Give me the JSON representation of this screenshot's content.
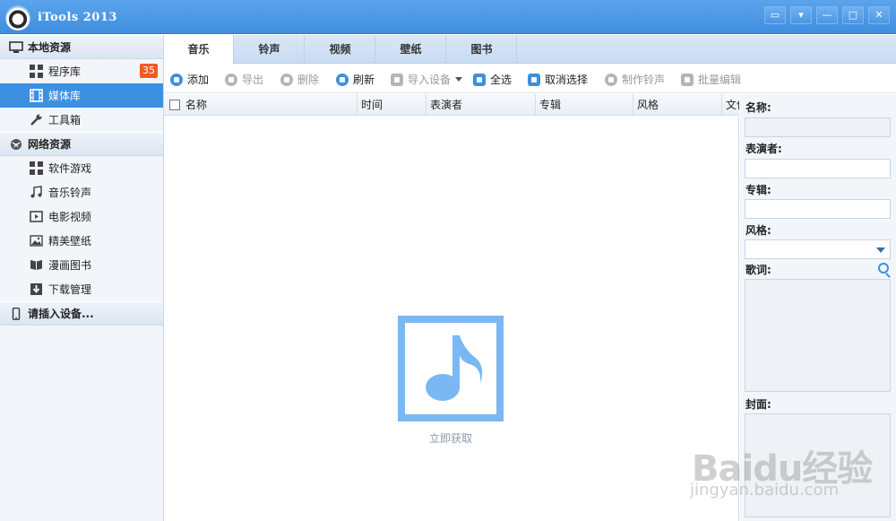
{
  "app": {
    "title": "iTools 2013"
  },
  "window_buttons": [
    "▭",
    "▾",
    "—",
    "□",
    "✕"
  ],
  "sidebar": {
    "sections": [
      {
        "label": "本地资源",
        "icon": "monitor-icon",
        "items": [
          {
            "label": "程序库",
            "icon": "grid-icon",
            "badge": "35",
            "active": false
          },
          {
            "label": "媒体库",
            "icon": "film-icon",
            "active": true
          },
          {
            "label": "工具箱",
            "icon": "wrench-icon",
            "active": false
          }
        ]
      },
      {
        "label": "网络资源",
        "icon": "globe-icon",
        "items": [
          {
            "label": "软件游戏",
            "icon": "grid-icon"
          },
          {
            "label": "音乐铃声",
            "icon": "music-note-icon"
          },
          {
            "label": "电影视频",
            "icon": "video-icon"
          },
          {
            "label": "精美壁纸",
            "icon": "picture-icon"
          },
          {
            "label": "漫画图书",
            "icon": "book-icon"
          },
          {
            "label": "下载管理",
            "icon": "download-icon"
          }
        ]
      },
      {
        "label": "请插入设备...",
        "icon": "phone-icon",
        "items": []
      }
    ]
  },
  "tabs": [
    "音乐",
    "铃声",
    "视频",
    "壁纸",
    "图书"
  ],
  "active_tab": "音乐",
  "toolbar": [
    {
      "label": "添加",
      "enabled": true,
      "icon": "add-icon"
    },
    {
      "label": "导出",
      "enabled": false,
      "icon": "export-icon"
    },
    {
      "label": "删除",
      "enabled": false,
      "icon": "delete-icon"
    },
    {
      "label": "刷新",
      "enabled": true,
      "icon": "refresh-icon"
    },
    {
      "label": "导入设备",
      "enabled": false,
      "icon": "import-device-icon",
      "dropdown": true
    },
    {
      "label": "全选",
      "enabled": true,
      "icon": "select-all-icon"
    },
    {
      "label": "取消选择",
      "enabled": true,
      "icon": "deselect-icon"
    },
    {
      "label": "制作铃声",
      "enabled": false,
      "icon": "make-ringtone-icon"
    },
    {
      "label": "批量编辑",
      "enabled": false,
      "icon": "batch-edit-icon"
    }
  ],
  "table": {
    "columns": [
      "名称",
      "时间",
      "表演者",
      "专辑",
      "风格",
      "文件"
    ],
    "rows": []
  },
  "empty_state": {
    "icon": "music-note-icon",
    "label": "立即获取"
  },
  "details": {
    "name_label": "名称:",
    "artist_label": "表演者:",
    "album_label": "专辑:",
    "genre_label": "风格:",
    "lyrics_label": "歌词:",
    "cover_label": "封面:"
  },
  "watermark": {
    "main": "Baidu经验",
    "sub": "jingyan.baidu.com"
  }
}
